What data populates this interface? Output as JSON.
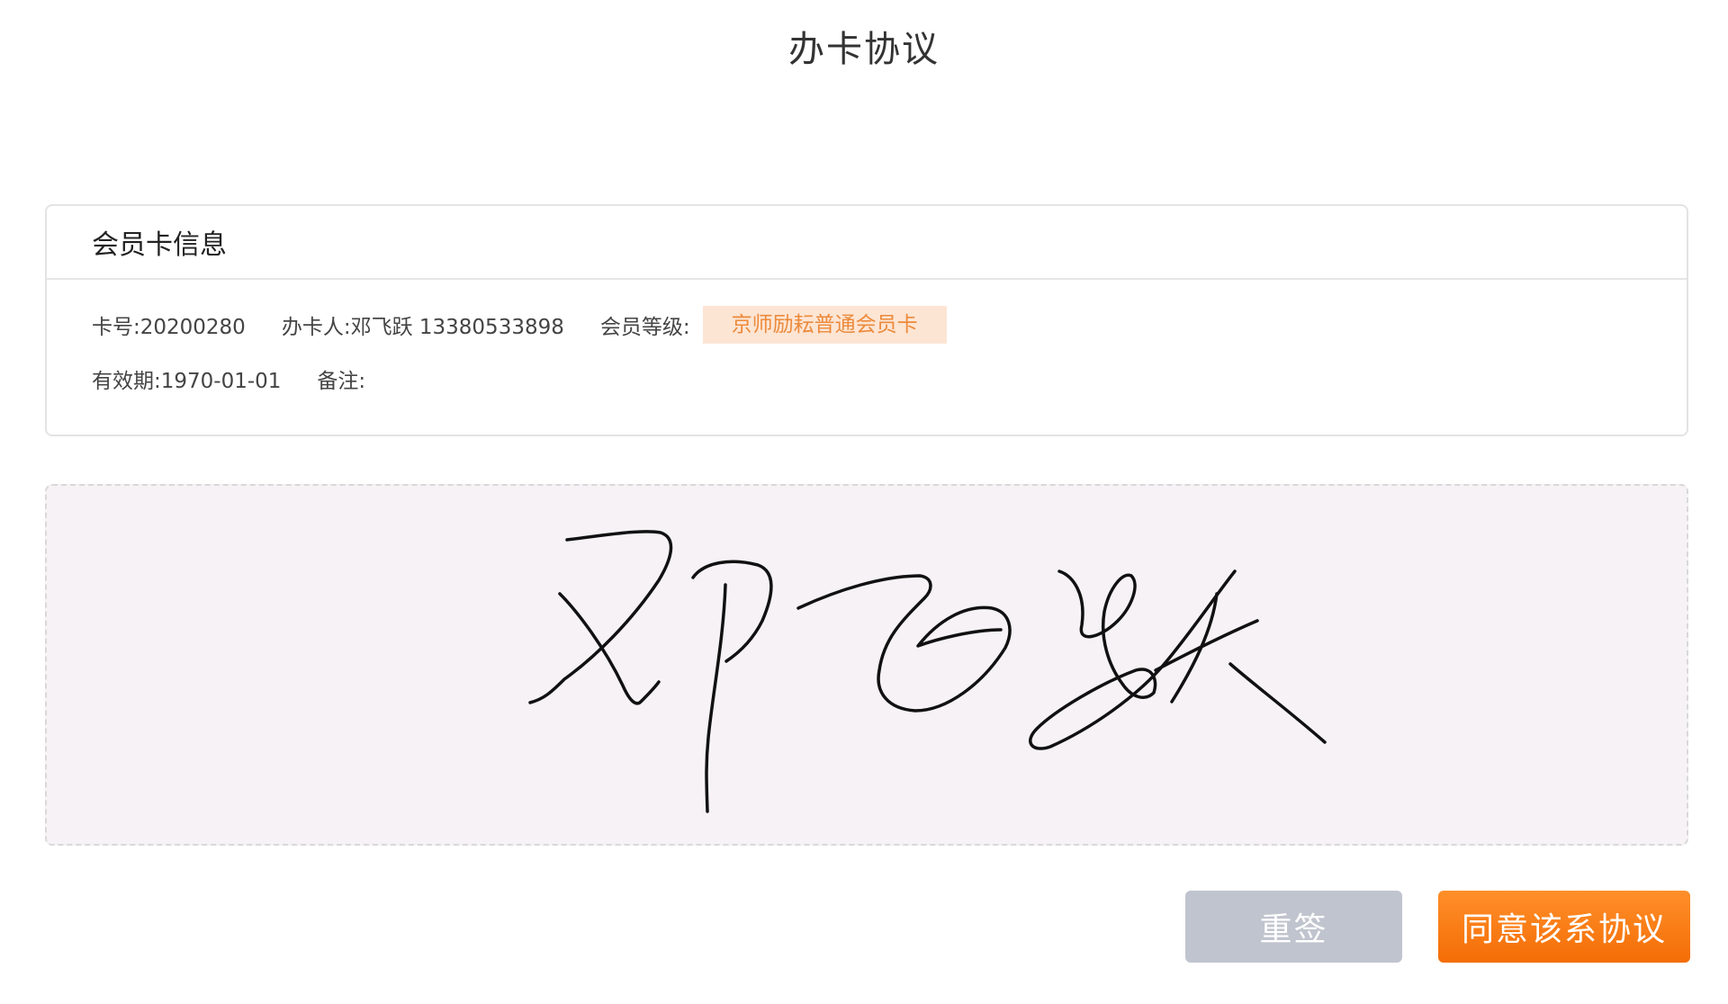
{
  "page": {
    "title": "办卡协议"
  },
  "card_info": {
    "header": "会员卡信息",
    "card_no": "卡号:20200280",
    "holder": "办卡人:邓飞跃 13380533898",
    "level_label": "会员等级:",
    "level_value": "京师励耘普通会员卡",
    "expiry": "有效期:1970-01-01",
    "remark": "备注:"
  },
  "signature": {
    "ink_color": "#111111",
    "area_background": "#f6f2f5",
    "signed_name": "邓飞跃"
  },
  "actions": {
    "resign_label": "重签",
    "agree_label": "同意该系协议"
  },
  "colors": {
    "accent": "#f57a16",
    "badge_bg": "#fde5d4",
    "badge_text": "#ec8a3b",
    "disabled_button": "#c0c4ce"
  }
}
